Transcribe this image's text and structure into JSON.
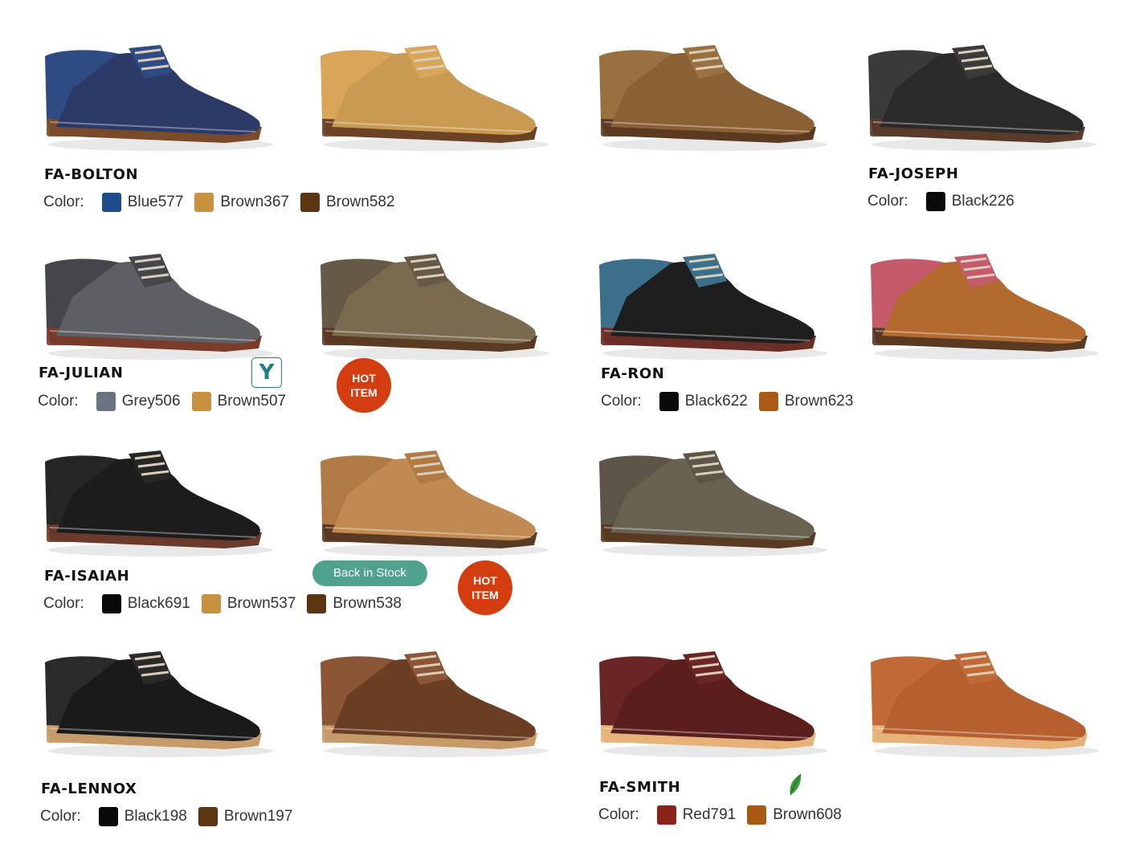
{
  "products": [
    {
      "model": "FA-BOLTON",
      "color_label": "Color:",
      "colors": [
        {
          "name": "Blue577",
          "hex": "#1d4b8c"
        },
        {
          "name": "Brown367",
          "hex": "#c8913f"
        },
        {
          "name": "Brown582",
          "hex": "#5b3410"
        }
      ]
    },
    {
      "model": "FA-JOSEPH",
      "color_label": "Color:",
      "colors": [
        {
          "name": "Black226",
          "hex": "#0a0a0a"
        }
      ]
    },
    {
      "model": "FA-JULIAN",
      "color_label": "Color:",
      "colors": [
        {
          "name": "Grey506",
          "hex": "#6b7280"
        },
        {
          "name": "Brown507",
          "hex": "#c8913f"
        }
      ]
    },
    {
      "model": "FA-RON",
      "color_label": "Color:",
      "colors": [
        {
          "name": "Black622",
          "hex": "#0a0a0a"
        },
        {
          "name": "Brown623",
          "hex": "#a85a15"
        }
      ]
    },
    {
      "model": "FA-ISAIAH",
      "color_label": "Color:",
      "colors": [
        {
          "name": "Black691",
          "hex": "#0a0a0a"
        },
        {
          "name": "Brown537",
          "hex": "#c8913f"
        },
        {
          "name": "Brown538",
          "hex": "#5b3410"
        }
      ]
    },
    {
      "model": "FA-LENNOX",
      "color_label": "Color:",
      "colors": [
        {
          "name": "Black198",
          "hex": "#0a0a0a"
        },
        {
          "name": "Brown197",
          "hex": "#5b3410"
        }
      ]
    },
    {
      "model": "FA-SMITH",
      "color_label": "Color:",
      "colors": [
        {
          "name": "Red791",
          "hex": "#8b2318"
        },
        {
          "name": "Brown608",
          "hex": "#a85a15"
        }
      ]
    }
  ],
  "badges": {
    "hot": "HOT\nITEM",
    "back_in_stock": "Back in Stock",
    "y_badge": "Y"
  },
  "shoe_images": [
    {
      "name": "bolton-blue",
      "upper": "#2c3a68",
      "quarter": "#2f4b84",
      "sole": "#7a4a2a"
    },
    {
      "name": "bolton-brown367",
      "upper": "#c99a52",
      "quarter": "#d9a558",
      "sole": "#6b4226"
    },
    {
      "name": "bolton-brown582",
      "upper": "#8a6035",
      "quarter": "#9b7040",
      "sole": "#5c3a22"
    },
    {
      "name": "joseph-black",
      "upper": "#2a2a2a",
      "quarter": "#3a3a3a",
      "sole": "#5a3a28"
    },
    {
      "name": "julian-grey",
      "upper": "#5d5f63",
      "quarter": "#44464c",
      "sole": "#7a3b2b"
    },
    {
      "name": "julian-brown",
      "upper": "#7a6a4e",
      "quarter": "#665a46",
      "sole": "#5a3a22"
    },
    {
      "name": "ron-black",
      "upper": "#1e1e1e",
      "quarter": "#3b6f8a",
      "sole": "#6b2e26"
    },
    {
      "name": "ron-brown",
      "upper": "#b36a2e",
      "quarter": "#c45a6a",
      "sole": "#5a3a22"
    },
    {
      "name": "isaiah-black",
      "upper": "#1c1c1c",
      "quarter": "#262626",
      "sole": "#6b3a2a"
    },
    {
      "name": "isaiah-brown537",
      "upper": "#c08a52",
      "quarter": "#b07a45",
      "sole": "#5a3a22"
    },
    {
      "name": "isaiah-grey",
      "upper": "#6a6250",
      "quarter": "#5d5648",
      "sole": "#5a3a22"
    },
    {
      "name": "lennox-black",
      "upper": "#1a1a1a",
      "quarter": "#2a2a2a",
      "sole": "#c79a6a"
    },
    {
      "name": "lennox-brown",
      "upper": "#6a3e22",
      "quarter": "#8a5636",
      "sole": "#c79a6a"
    },
    {
      "name": "smith-red",
      "upper": "#5a1e1c",
      "quarter": "#6a2624",
      "sole": "#e6b27a"
    },
    {
      "name": "smith-brown",
      "upper": "#b5602e",
      "quarter": "#c06a38",
      "sole": "#e6b27a"
    }
  ]
}
